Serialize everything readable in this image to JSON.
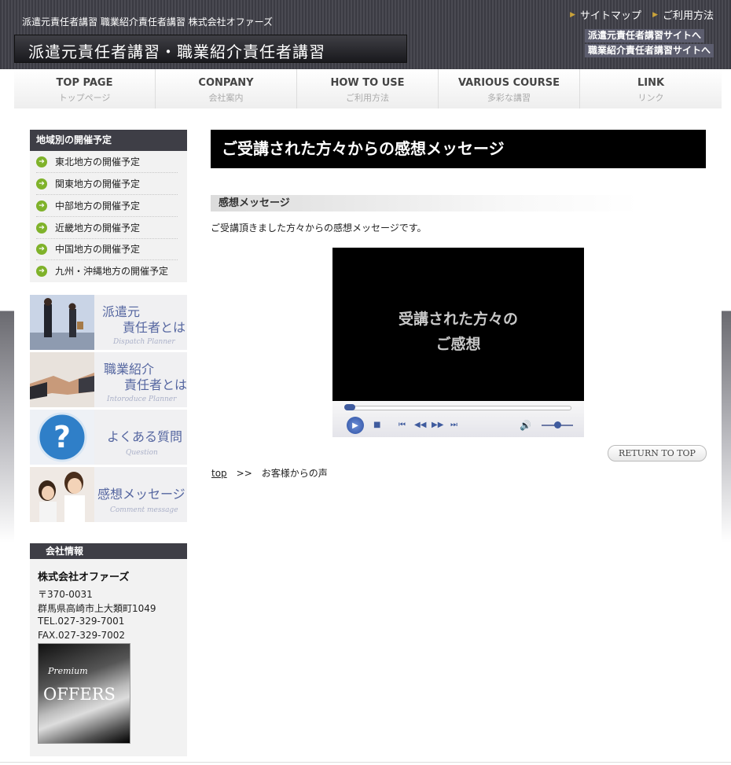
{
  "header": {
    "tagline": "派遣元責任者講習 職業紹介責任者講習 株式会社オファーズ",
    "site_title": "派遣元責任者講習・職業紹介責任者講習",
    "top_links": [
      "サイトマップ",
      "ご利用方法"
    ],
    "site_links": [
      "派遣元責任者講習サイトへ",
      "職業紹介責任者講習サイトへ"
    ]
  },
  "nav": [
    {
      "en": "TOP PAGE",
      "jp": "トップページ"
    },
    {
      "en": "CONPANY",
      "jp": "会社案内"
    },
    {
      "en": "HOW TO USE",
      "jp": "ご利用方法"
    },
    {
      "en": "VARIOUS COURSE",
      "jp": "多彩な講習"
    },
    {
      "en": "LINK",
      "jp": "リンク"
    }
  ],
  "sidebar": {
    "schedule_title": "地域別の開催予定",
    "schedule_items": [
      "東北地方の開催予定",
      "関東地方の開催予定",
      "中部地方の開催予定",
      "近畿地方の開催予定",
      "中国地方の開催予定",
      "九州・沖縄地方の開催予定"
    ],
    "banners": [
      {
        "title1": "派遣元",
        "title2": "責任者とは",
        "sub": "Dispatch Planner"
      },
      {
        "title1": "職業紹介",
        "title2": "責任者とは",
        "sub": "Intoroduce Planner"
      },
      {
        "title1": "よくある質問",
        "title2": "",
        "sub": "Question"
      },
      {
        "title1": "感想メッセージ",
        "title2": "",
        "sub": "Comment message"
      }
    ],
    "company_info": {
      "title": "会社情報",
      "name": "株式会社オファーズ",
      "postal": "〒370-0031",
      "address": "群馬県高崎市上大類町1049",
      "tel": "TEL.027-329-7001",
      "fax": "FAX.027-329-7002",
      "logo_premium": "Premium",
      "logo_brand": "OFFERS"
    }
  },
  "main": {
    "heading": "ご受講された方々からの感想メッセージ",
    "subheading": "感想メッセージ",
    "intro": "ご受講頂きました方々からの感想メッセージです。",
    "video_text_line1": "受講された方々の",
    "video_text_line2": "ご感想",
    "return_label": "RETURN TO TOP",
    "breadcrumb": {
      "home": "top",
      "sep": ">>",
      "current": "お客様からの声"
    }
  }
}
